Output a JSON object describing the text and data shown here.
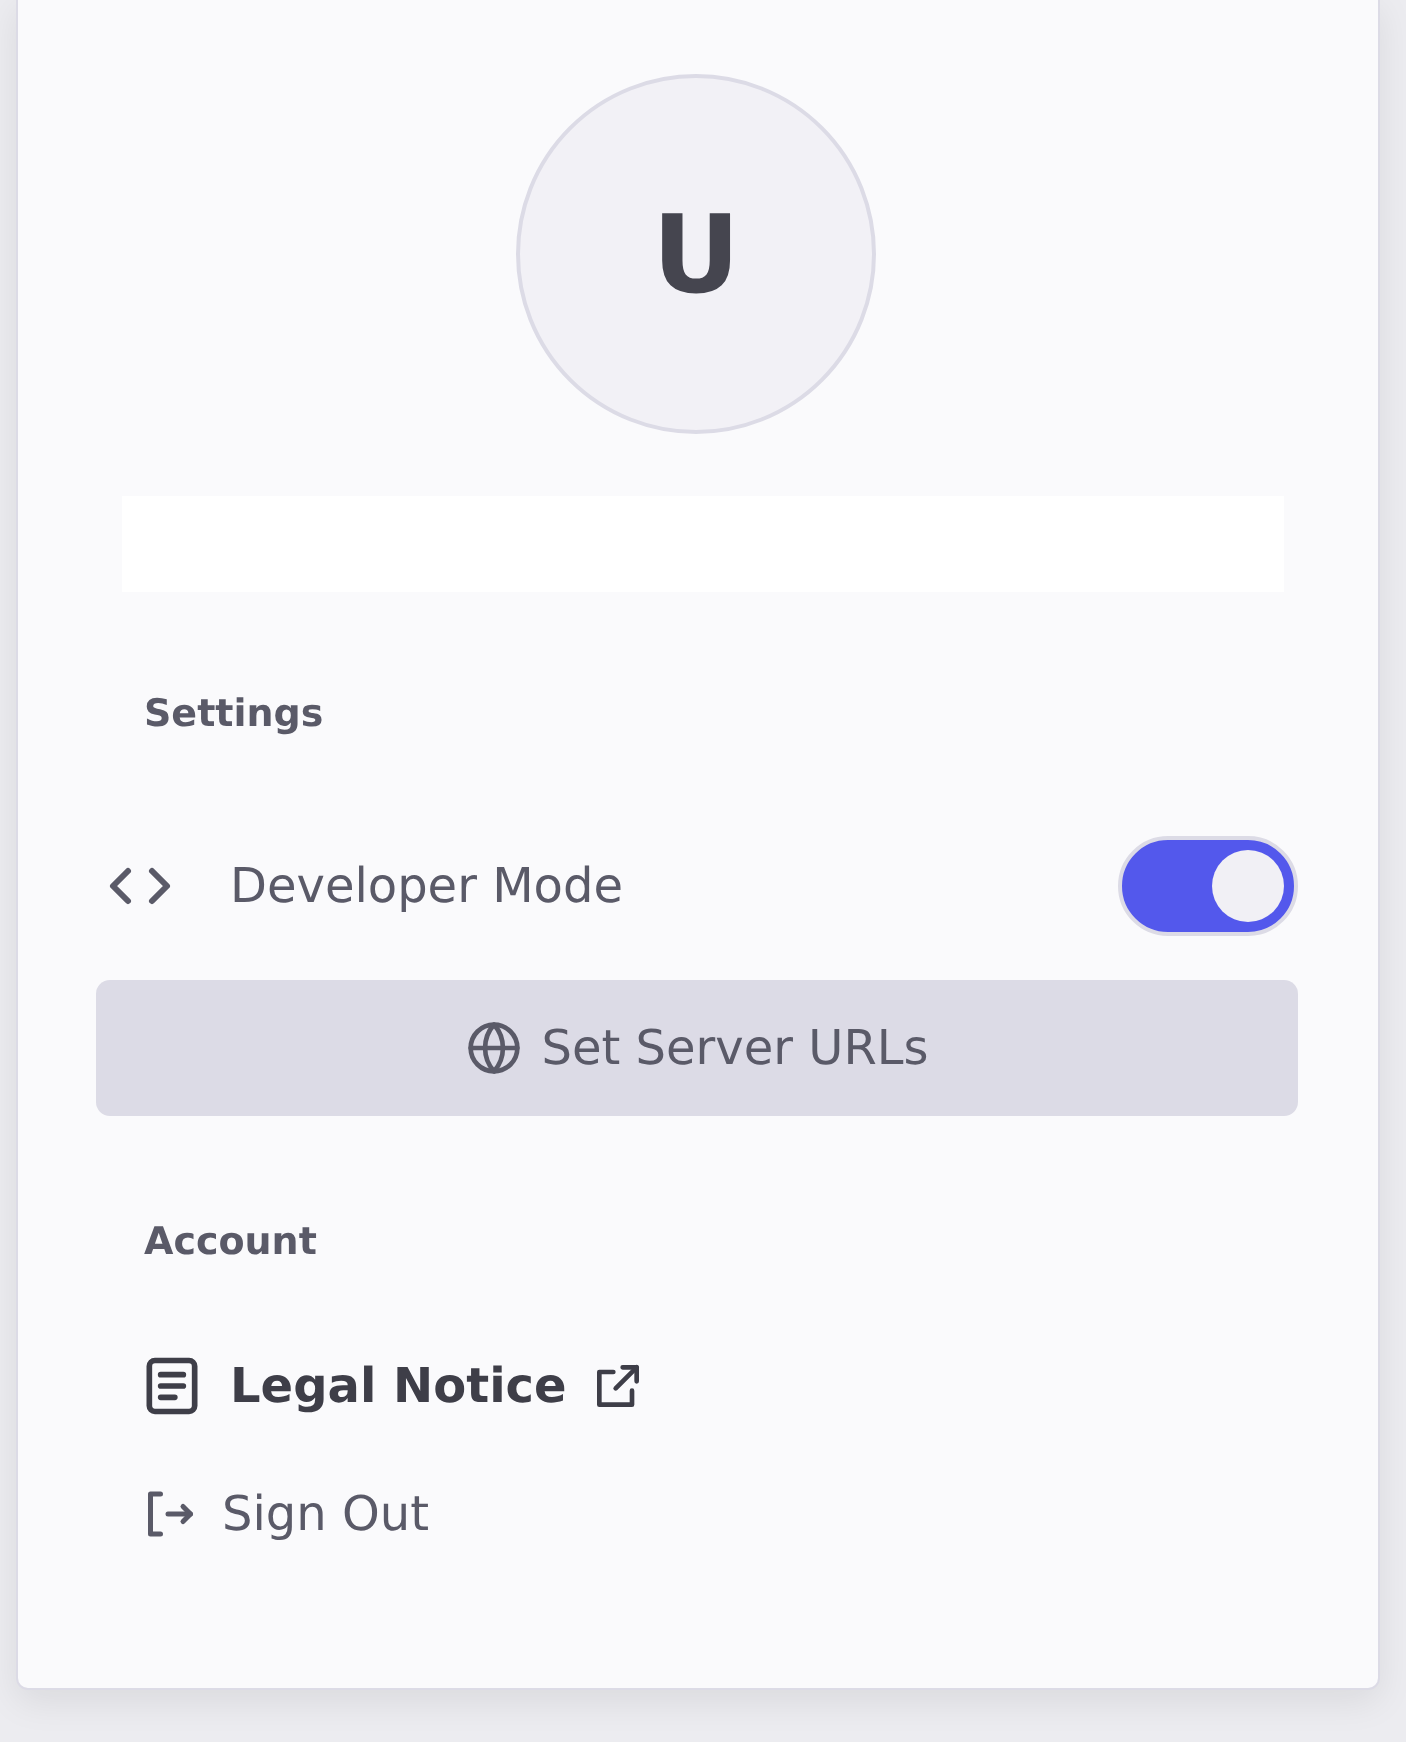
{
  "avatar": {
    "initial": "U"
  },
  "settings": {
    "heading": "Settings",
    "developer_mode": {
      "label": "Developer Mode",
      "on": true
    },
    "server_button": {
      "label": "Set Server URLs"
    }
  },
  "account": {
    "heading": "Account",
    "items": [
      {
        "kind": "external",
        "label": "Legal Notice"
      },
      {
        "kind": "signout",
        "label": "Sign Out"
      }
    ]
  }
}
